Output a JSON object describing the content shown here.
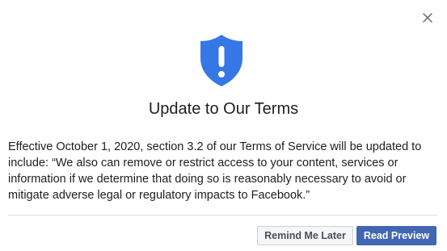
{
  "dialog": {
    "title": "Update to Our Terms",
    "body_line_1": "Effective October 1, 2020, section 3.2 of our Terms of Service will be updated to",
    "body_line_2": "include: “We also can remove or restrict access to your content, services or",
    "body_line_3": "information if we determine that doing so is reasonably necessary to avoid or",
    "body_line_4": "mitigate adverse legal or regulatory impacts to Facebook.”"
  },
  "buttons": {
    "remind_later": "Remind Me Later",
    "read_preview": "Read Preview"
  },
  "icons": {
    "close": "close-icon",
    "shield": "shield-alert-icon"
  },
  "colors": {
    "accent": "#4267b2",
    "shield": "#3578e5",
    "text": "#1c1e21"
  }
}
